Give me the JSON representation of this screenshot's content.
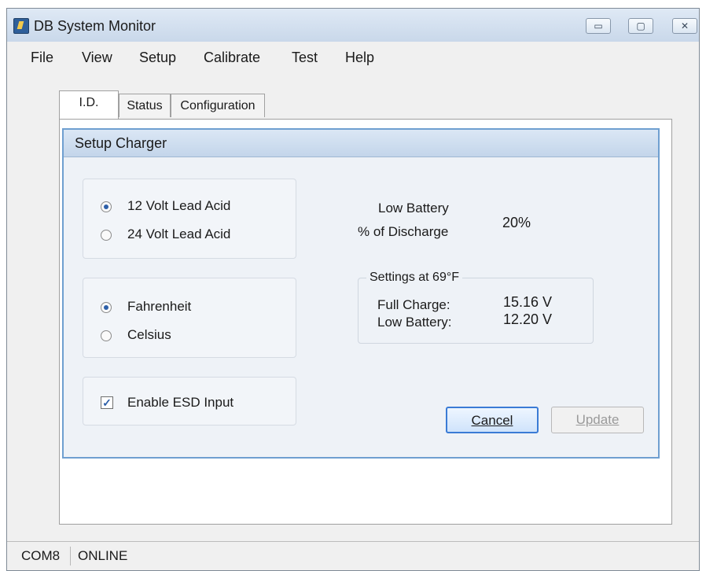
{
  "window": {
    "title": "DB System Monitor",
    "minimize": "▭",
    "maximize": "▢",
    "close": "✕"
  },
  "menu": [
    "File",
    "View",
    "Setup",
    "Calibrate",
    "Test",
    "Help"
  ],
  "tabs": [
    "I.D.",
    "Status",
    "Configuration"
  ],
  "dialog": {
    "title": "Setup Charger",
    "battery_options": [
      "12 Volt Lead Acid",
      "24 Volt Lead Acid"
    ],
    "temp_options": [
      "Fahrenheit",
      "Celsius"
    ],
    "esd_label": "Enable ESD Input",
    "low_battery_label1": "Low Battery",
    "low_battery_label2": "% of Discharge",
    "low_battery_value": "20%",
    "settings_title": "Settings at 69°F",
    "full_charge_label": "Full Charge:",
    "full_charge_value": "15.16 V",
    "low_battery_setting_label": "Low Battery:",
    "low_battery_setting_value": "12.20 V",
    "cancel_label": "Cancel",
    "update_label": "Update"
  },
  "status": {
    "port": "COM8",
    "state": "ONLINE"
  },
  "colors": {
    "accent": "#3a7bd5",
    "title_gradient": "#c9d8ea"
  }
}
